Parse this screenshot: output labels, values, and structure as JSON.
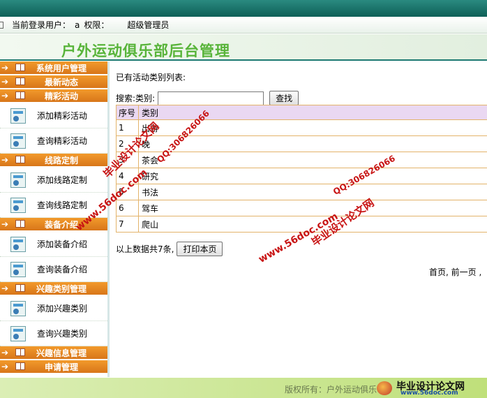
{
  "header": {
    "login_label": "当前登录用户：",
    "user_name": "a",
    "role_label": "权限：",
    "role_value": "超级管理员",
    "app_title": "户外运动俱乐部后台管理"
  },
  "sidebar": {
    "categories": [
      {
        "label": "系统用户管理",
        "items": []
      },
      {
        "label": "最新动态",
        "items": []
      },
      {
        "label": "精彩活动",
        "items": [
          "添加精彩活动",
          "查询精彩活动"
        ]
      },
      {
        "label": "线路定制",
        "items": [
          "添加线路定制",
          "查询线路定制"
        ]
      },
      {
        "label": "装备介绍",
        "items": [
          "添加装备介绍",
          "查询装备介绍"
        ]
      },
      {
        "label": "兴趣类别管理",
        "items": [
          "添加兴趣类别",
          "查询兴趣类别"
        ]
      },
      {
        "label": "兴趣信息管理",
        "items": []
      },
      {
        "label": "申请管理",
        "items": []
      }
    ]
  },
  "main": {
    "list_title": "已有活动类别列表:",
    "search_label": "搜索:类别:",
    "search_value": "",
    "search_button": "查找",
    "table": {
      "headers": [
        "序号",
        "类别"
      ],
      "rows": [
        [
          "1",
          "出游"
        ],
        [
          "2",
          "晚"
        ],
        [
          "3",
          "茶会"
        ],
        [
          "4",
          "研究"
        ],
        [
          "5",
          "书法"
        ],
        [
          "6",
          "驾车"
        ],
        [
          "7",
          "爬山"
        ]
      ]
    },
    "summary_text": "以上数据共7条,",
    "print_button": "打印本页",
    "pager_text": "首页, 前一页 ,"
  },
  "footer": {
    "copyright": "版权所有：户外运动俱乐",
    "logo_text": "毕业设计论文网",
    "logo_site": "www.56doc.com"
  },
  "watermarks": {
    "text1": "毕业设计论文网",
    "text2": "www.56doc.com",
    "text3": "QQ:306826066"
  },
  "colors": {
    "accent_orange": "#e8891f",
    "title_green": "#58b43a",
    "topbar_teal": "#1d7a72",
    "table_border": "#e3b36a",
    "table_header_bg": "#ead8f2"
  }
}
